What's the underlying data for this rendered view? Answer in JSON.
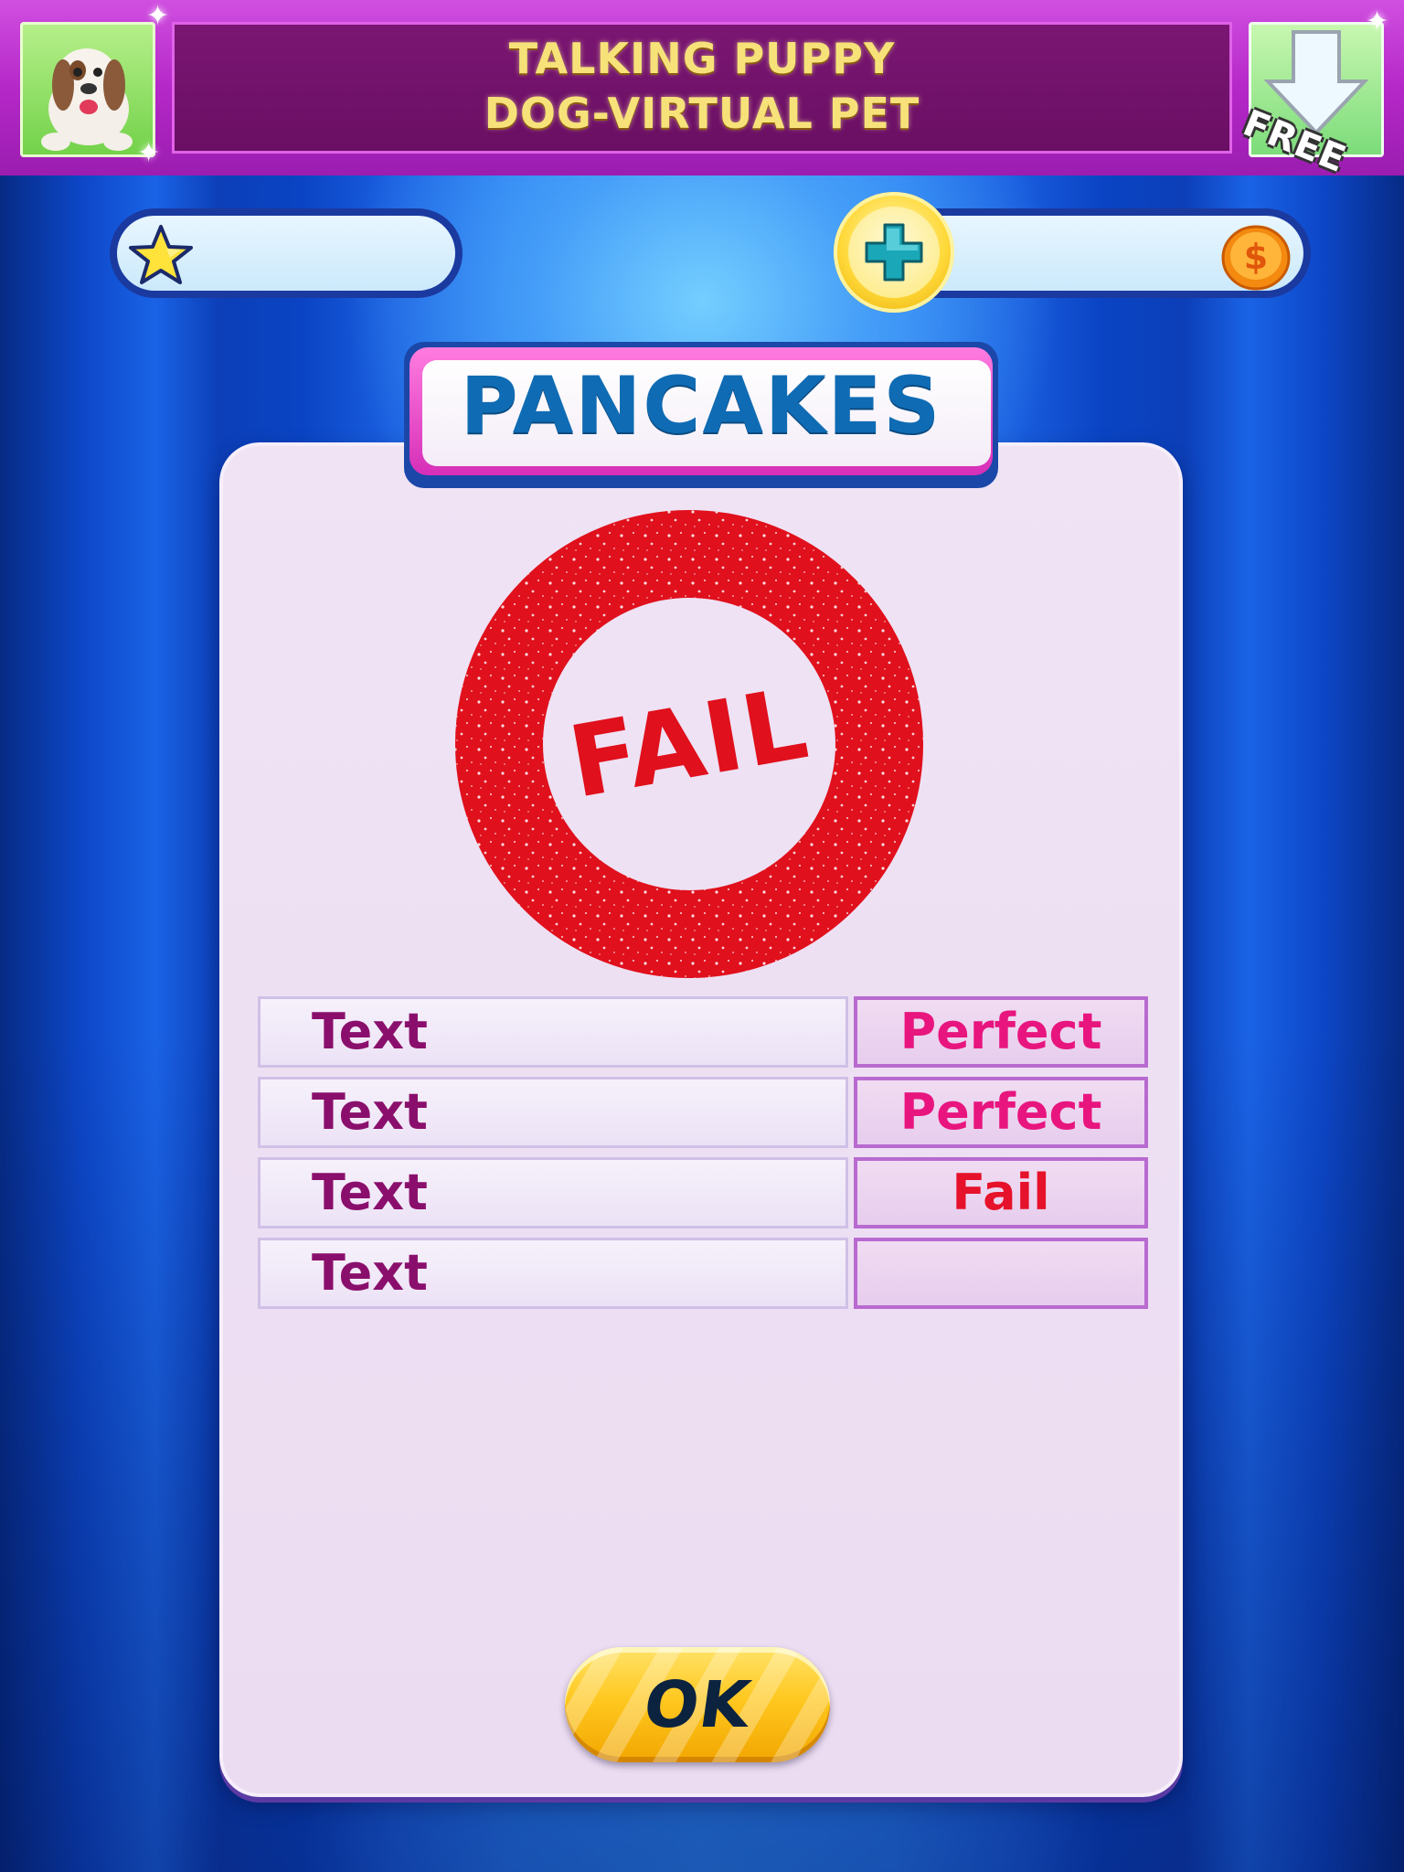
{
  "ad_banner": {
    "title_line1": "TALKING PUPPY",
    "title_line2": "DOG-VIRTUAL PET",
    "badge": "FREE",
    "left_image_icon": "puppy-icon",
    "right_image_icon": "download-arrow-icon"
  },
  "status": {
    "star_icon": "star-icon",
    "plus_icon": "plus-icon",
    "coin_icon": "dollar-coin-icon"
  },
  "title": "PANCAKES",
  "stamp": {
    "text": "FAIL",
    "color": "#e0101c"
  },
  "results": [
    {
      "label": "Text",
      "value": "Perfect",
      "value_color": "#e8157e"
    },
    {
      "label": "Text",
      "value": "Perfect",
      "value_color": "#e8157e"
    },
    {
      "label": "Text",
      "value": "Fail",
      "value_color": "#e6112a"
    },
    {
      "label": "Text",
      "value": "",
      "value_color": "#e8157e"
    }
  ],
  "ok_button": {
    "label": "OK"
  },
  "colors": {
    "title": "#0f6cb4",
    "row_label": "#8a0f6c",
    "banner": "#b528c8"
  }
}
